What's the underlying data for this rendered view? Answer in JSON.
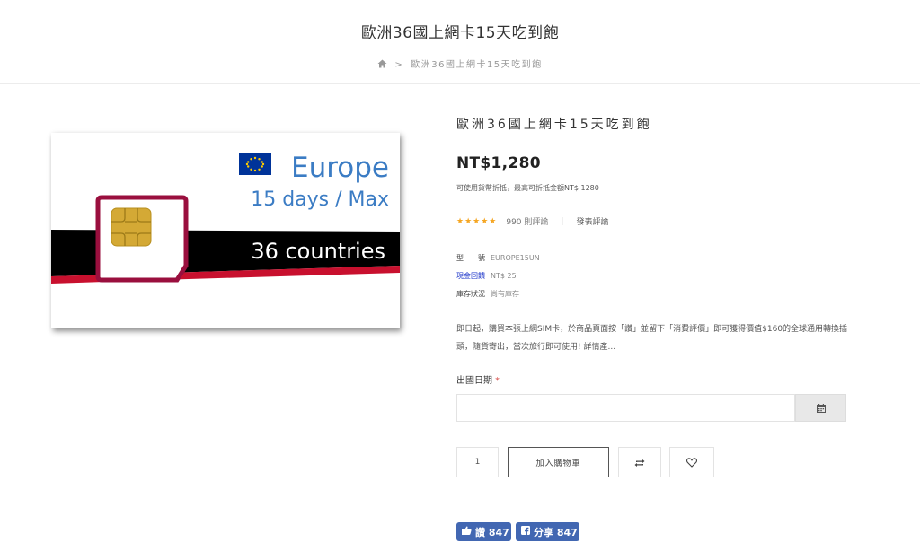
{
  "header": {
    "title": "歐洲36國上網卡15天吃到飽",
    "breadcrumb": {
      "home_icon": "home-icon",
      "separator": ">",
      "current": "歐洲36國上網卡15天吃到飽"
    }
  },
  "product_image": {
    "region": "Europe",
    "plan": "15 days / Max",
    "countries": "36 countries",
    "colors": {
      "blue_text": "#3b7cc4",
      "black_band": "#000000",
      "red_stripe": "#c8102e",
      "sim_frame": "#9a0f3e",
      "chip": "#d4a935",
      "eu_flag": "#003399",
      "eu_star": "#ffcc00"
    }
  },
  "product": {
    "name": "歐洲36國上網卡15天吃到飽",
    "price": "NT$1,280",
    "discount_note": "可使用貨幣折抵，最高可折抵金額NT$ 1280",
    "rating": {
      "stars": 5,
      "count_text": "990 則評論",
      "write_review": "發表評論",
      "star_color": "#f5a623"
    },
    "specs": {
      "model_label": "型　　號",
      "model_value": "EUROPE15UN",
      "cashback_label": "現金回饋",
      "cashback_value": "NT$ 25",
      "stock_label": "庫存狀況",
      "stock_value": "尚有庫存"
    },
    "description": "即日起，購買本張上網SIM卡，於商品頁面按「讚」並留下「消費評價」即可獲得價值$160的全球通用轉換插頭，隨貨寄出，當次旅行即可使用! 詳情產...",
    "date_field": {
      "label": "出國日期",
      "required_mark": "*",
      "value": ""
    },
    "quantity": "1",
    "add_to_cart": "加入購物車"
  },
  "social": {
    "like_label": "讚 847",
    "share_label": "分享 847",
    "color": "#4267b2"
  }
}
